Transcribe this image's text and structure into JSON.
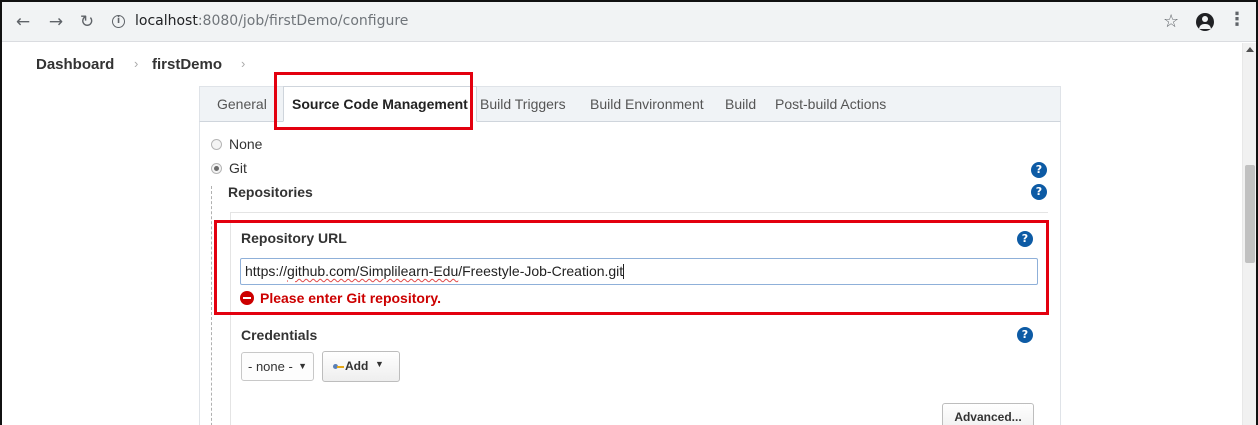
{
  "browser": {
    "back_icon": "arrow-left-icon",
    "forward_icon": "arrow-right-icon",
    "reload_icon": "reload-icon",
    "info_glyph": "i",
    "url_host": "localhost",
    "url_path": ":8080/job/firstDemo/configure",
    "bookmark_icon": "star-icon",
    "profile_icon": "profile-icon",
    "menu_icon": "kebab-menu-icon"
  },
  "breadcrumb": {
    "items": [
      "Dashboard",
      "firstDemo"
    ],
    "separator": "›"
  },
  "tabs": [
    {
      "label": "General",
      "active": false
    },
    {
      "label": "Source Code Management",
      "active": true
    },
    {
      "label": "Build Triggers",
      "active": false
    },
    {
      "label": "Build Environment",
      "active": false
    },
    {
      "label": "Build",
      "active": false
    },
    {
      "label": "Post-build Actions",
      "active": false
    }
  ],
  "scm": {
    "options": [
      {
        "label": "None",
        "selected": false
      },
      {
        "label": "Git",
        "selected": true
      }
    ],
    "repositories_label": "Repositories",
    "repo_url_label": "Repository URL",
    "repo_url_value_prefix": "https://",
    "repo_url_value_underlined": "github.com/Simplilearn-Edu",
    "repo_url_value_suffix": "/Freestyle-Job-Creation.git",
    "error_message": "Please enter Git repository.",
    "credentials_label": "Credentials",
    "credentials_selected": "- none -",
    "add_button": "Add",
    "advanced_button": "Advanced..."
  },
  "help_glyph": "?",
  "colors": {
    "annotation": "#e3000f",
    "error": "#cc0000",
    "help": "#0d5ba5"
  }
}
